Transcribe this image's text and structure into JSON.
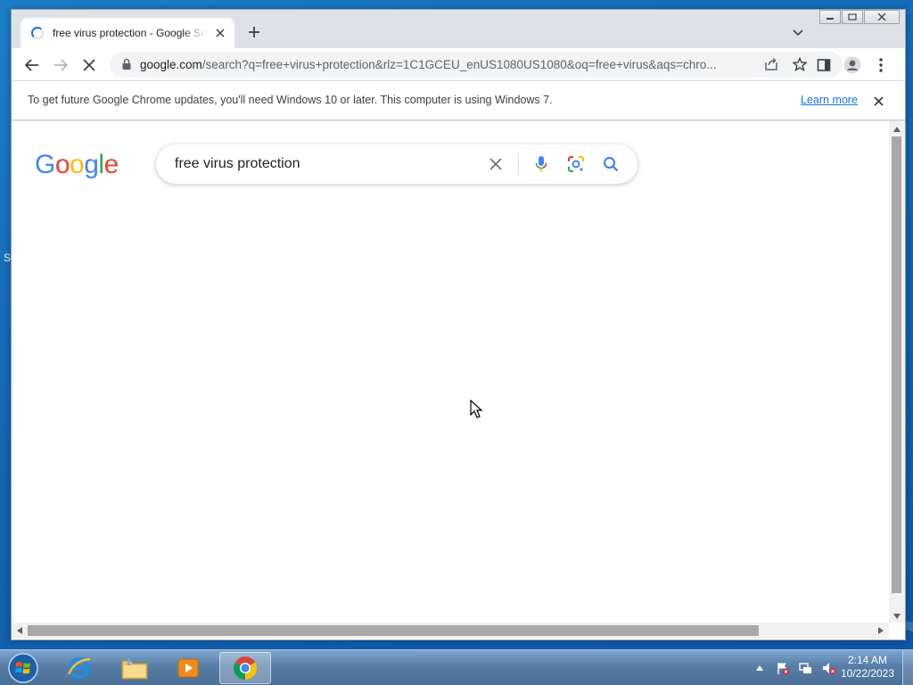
{
  "browser": {
    "tab": {
      "title": "free virus protection - Google Search"
    },
    "address": {
      "host": "google.com",
      "path": "/search?q=free+virus+protection&rlz=1C1GCEU_enUS1080US1080&oq=free+virus&aqs=chro..."
    },
    "infobar": {
      "message": "To get future Google Chrome updates, you'll need Windows 10 or later. This computer is using Windows 7.",
      "link": "Learn more"
    }
  },
  "page": {
    "logo": {
      "letters": [
        "G",
        "o",
        "o",
        "g",
        "l",
        "e"
      ]
    },
    "search": {
      "query": "free virus protection"
    }
  },
  "desktop": {
    "edge_text": "S"
  },
  "taskbar": {
    "apps": [
      "internet-explorer",
      "file-explorer",
      "media-player",
      "chrome"
    ],
    "clock": {
      "time": "2:14 AM",
      "date": "10/22/2023"
    }
  },
  "colors": {
    "google_blue": "#4285F4",
    "google_red": "#EA4335",
    "google_yellow": "#FBBC05",
    "google_green": "#34A853",
    "link_blue": "#1a73e8"
  }
}
